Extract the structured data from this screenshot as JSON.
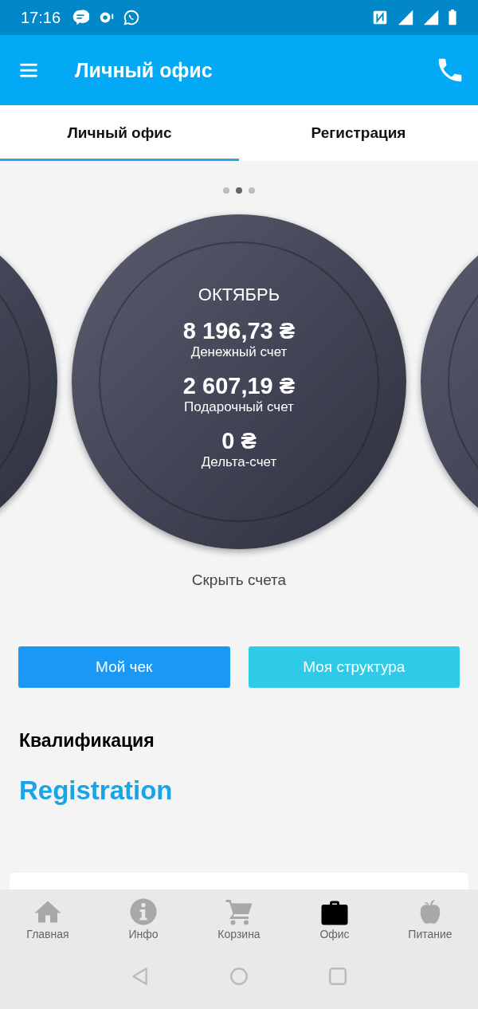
{
  "status_bar": {
    "time": "17:16"
  },
  "app_bar": {
    "title": "Личный офис"
  },
  "tabs": [
    {
      "label": "Личный офис",
      "selected": true
    },
    {
      "label": "Регистрация",
      "selected": false
    }
  ],
  "carousel": {
    "pages": [
      {
        "selected": false
      },
      {
        "selected": true
      },
      {
        "selected": false
      }
    ],
    "month": "ОКТЯБРЬ",
    "balances": [
      {
        "amount": "8 196,73 ₴",
        "label": "Денежный счет"
      },
      {
        "amount": "2 607,19 ₴",
        "label": "Подарочный счет"
      },
      {
        "amount": "0 ₴",
        "label": "Дельта-счет"
      }
    ],
    "toggle": "Скрыть счета"
  },
  "buttons": [
    {
      "label": "Мой чек",
      "kind": "primary"
    },
    {
      "label": "Моя структура",
      "kind": "secondary"
    }
  ],
  "qualification": {
    "heading": "Квалификация",
    "value": "Registration"
  },
  "bottom_nav": [
    {
      "label": "Главная",
      "kind": "home",
      "selected": false
    },
    {
      "label": "Инфо",
      "kind": "info",
      "selected": false
    },
    {
      "label": "Корзина",
      "kind": "cart",
      "selected": false
    },
    {
      "label": "Офис",
      "kind": "briefcase",
      "selected": true
    },
    {
      "label": "Питание",
      "kind": "apple",
      "selected": false
    }
  ]
}
